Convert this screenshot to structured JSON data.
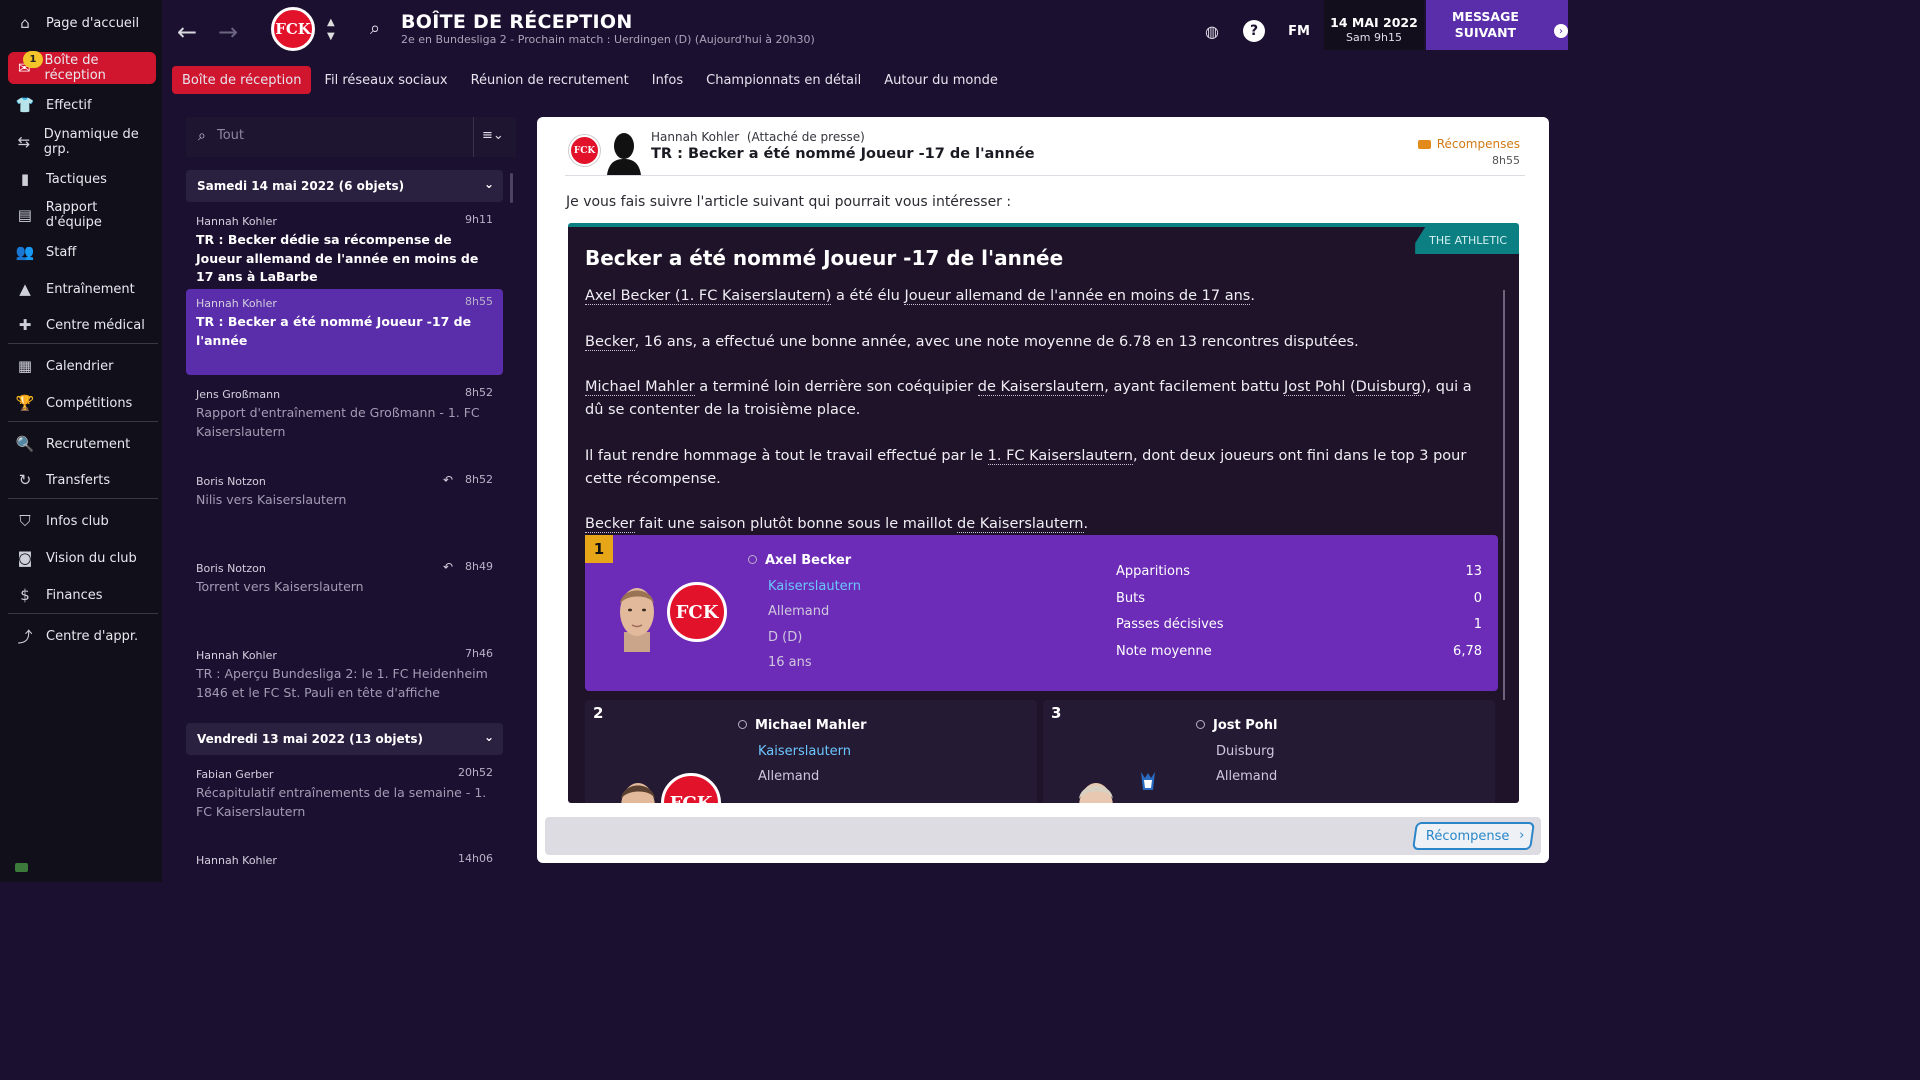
{
  "sidebar": {
    "items": [
      {
        "label": "Page d'accueil",
        "icon": "home-icon"
      },
      {
        "label": "Boîte de réception",
        "icon": "inbox-icon",
        "badge": "1"
      },
      {
        "label": "Effectif",
        "icon": "shirt-icon"
      },
      {
        "label": "Dynamique de grp.",
        "icon": "group-dynamics-icon"
      },
      {
        "label": "Tactiques",
        "icon": "tactics-icon"
      },
      {
        "label": "Rapport d'équipe",
        "icon": "report-icon"
      },
      {
        "label": "Staff",
        "icon": "staff-icon"
      },
      {
        "label": "Entraînement",
        "icon": "training-icon"
      },
      {
        "label": "Centre médical",
        "icon": "medical-icon"
      },
      {
        "label": "Calendrier",
        "icon": "calendar-icon"
      },
      {
        "label": "Compétitions",
        "icon": "trophy-icon"
      },
      {
        "label": "Recrutement",
        "icon": "scouting-icon"
      },
      {
        "label": "Transferts",
        "icon": "transfers-icon"
      },
      {
        "label": "Infos club",
        "icon": "club-info-icon"
      },
      {
        "label": "Vision du club",
        "icon": "club-vision-icon"
      },
      {
        "label": "Finances",
        "icon": "finances-icon"
      },
      {
        "label": "Centre d'appr.",
        "icon": "development-centre-icon"
      }
    ]
  },
  "header": {
    "title": "BOÎTE DE RÉCEPTION",
    "subtitle": "2e en Bundesliga 2 - Prochain match : Uerdingen (D) (Aujourd'hui à 20h30)",
    "club_logo_text": "FCK",
    "fm_label": "FM",
    "date": "14 MAI 2022",
    "time": "Sam 9h15",
    "next_label_1": "MESSAGE",
    "next_label_2": "SUIVANT"
  },
  "tabs": [
    "Boîte de réception",
    "Fil réseaux sociaux",
    "Réunion de recrutement",
    "Infos",
    "Championnats en détail",
    "Autour du monde"
  ],
  "search": {
    "placeholder": "Tout"
  },
  "sections": [
    {
      "label": "Samedi 14 mai 2022 (6 objets)"
    },
    {
      "label": "Vendredi 13 mai 2022 (13 objets)"
    }
  ],
  "messages": [
    {
      "sender": "Hannah Kohler",
      "time": "9h11",
      "subject": "TR : Becker dédie sa récompense de Joueur allemand de l'année en moins de 17 ans à LaBarbe"
    },
    {
      "sender": "Hannah Kohler",
      "time": "8h55",
      "subject": "TR : Becker a été nommé Joueur -17 de l'année"
    },
    {
      "sender": "Jens Großmann",
      "time": "8h52",
      "subject": "Rapport d'entraînement de Großmann - 1. FC Kaiserslautern"
    },
    {
      "sender": "Boris Notzon",
      "time": "8h52",
      "subject": "Nilis vers Kaiserslautern"
    },
    {
      "sender": "Boris Notzon",
      "time": "8h49",
      "subject": "Torrent vers Kaiserslautern"
    },
    {
      "sender": "Hannah Kohler",
      "time": "7h46",
      "subject": "TR : Aperçu Bundesliga 2: le 1. FC Heidenheim 1846 et le FC St. Pauli en tête d'affiche"
    },
    {
      "sender": "Fabian Gerber",
      "time": "20h52",
      "subject": "Récapitulatif entraînements de la semaine - 1. FC Kaiserslautern"
    },
    {
      "sender": "Hannah Kohler",
      "time": "14h06",
      "subject": ""
    }
  ],
  "message_view": {
    "sender": "Hannah Kohler",
    "role": "(Attaché de presse)",
    "subject": "TR : Becker a été nommé Joueur -17 de l'année",
    "tag": "Récompenses",
    "time": "8h55",
    "intro": "Je vous fais suivre l'article suivant qui pourrait vous intéresser :",
    "source": "THE ATHLETIC",
    "article_title": "Becker a été nommé Joueur -17 de l'année",
    "p1": {
      "a": "Axel Becker (1. FC Kaiserslautern)",
      "b": " a été élu ",
      "c": "Joueur allemand de l'année en moins de 17 ans",
      "d": "."
    },
    "p2": {
      "a": "Becker",
      "b": ", 16 ans, a effectué une bonne année, avec une note moyenne de 6.78 en 13 rencontres disputées."
    },
    "p3": {
      "a": "Michael Mahler",
      "b": " a terminé loin derrière son coéquipier ",
      "c": "de Kaiserslautern",
      "d": ", ayant facilement battu ",
      "e": "Jost Pohl",
      "f": " (",
      "g": "Duisburg",
      "h": "), qui a dû se contenter de la troisième place."
    },
    "p4": {
      "a": "Il faut rendre hommage à tout le travail effectué par le ",
      "b": "1. FC Kaiserslautern",
      "c": ", dont deux joueurs ont fini dans le top 3 pour cette récompense."
    },
    "p5": {
      "a": "Becker",
      "b": " fait une saison plutôt bonne sous le maillot ",
      "c": "de Kaiserslautern",
      "d": "."
    },
    "winners": [
      {
        "rank": "1",
        "name": "Axel Becker",
        "club": "Kaiserslautern",
        "nationality": "Allemand",
        "position": "D (D)",
        "age": "16 ans",
        "stats": [
          {
            "label": "Apparitions",
            "value": "13"
          },
          {
            "label": "Buts",
            "value": "0"
          },
          {
            "label": "Passes décisives",
            "value": "1"
          },
          {
            "label": "Note moyenne",
            "value": "6,78"
          }
        ]
      },
      {
        "rank": "2",
        "name": "Michael Mahler",
        "club": "Kaiserslautern",
        "nationality": "Allemand"
      },
      {
        "rank": "3",
        "name": "Jost Pohl",
        "club": "Duisburg",
        "nationality": "Allemand"
      }
    ],
    "action_button": "Récompense"
  },
  "colors": {
    "accent_red": "#d0162e",
    "accent_purple": "#5a2daa",
    "card_purple": "#6d2cb7",
    "teal": "#0c7f83",
    "badge_yellow": "#f3c52a"
  }
}
